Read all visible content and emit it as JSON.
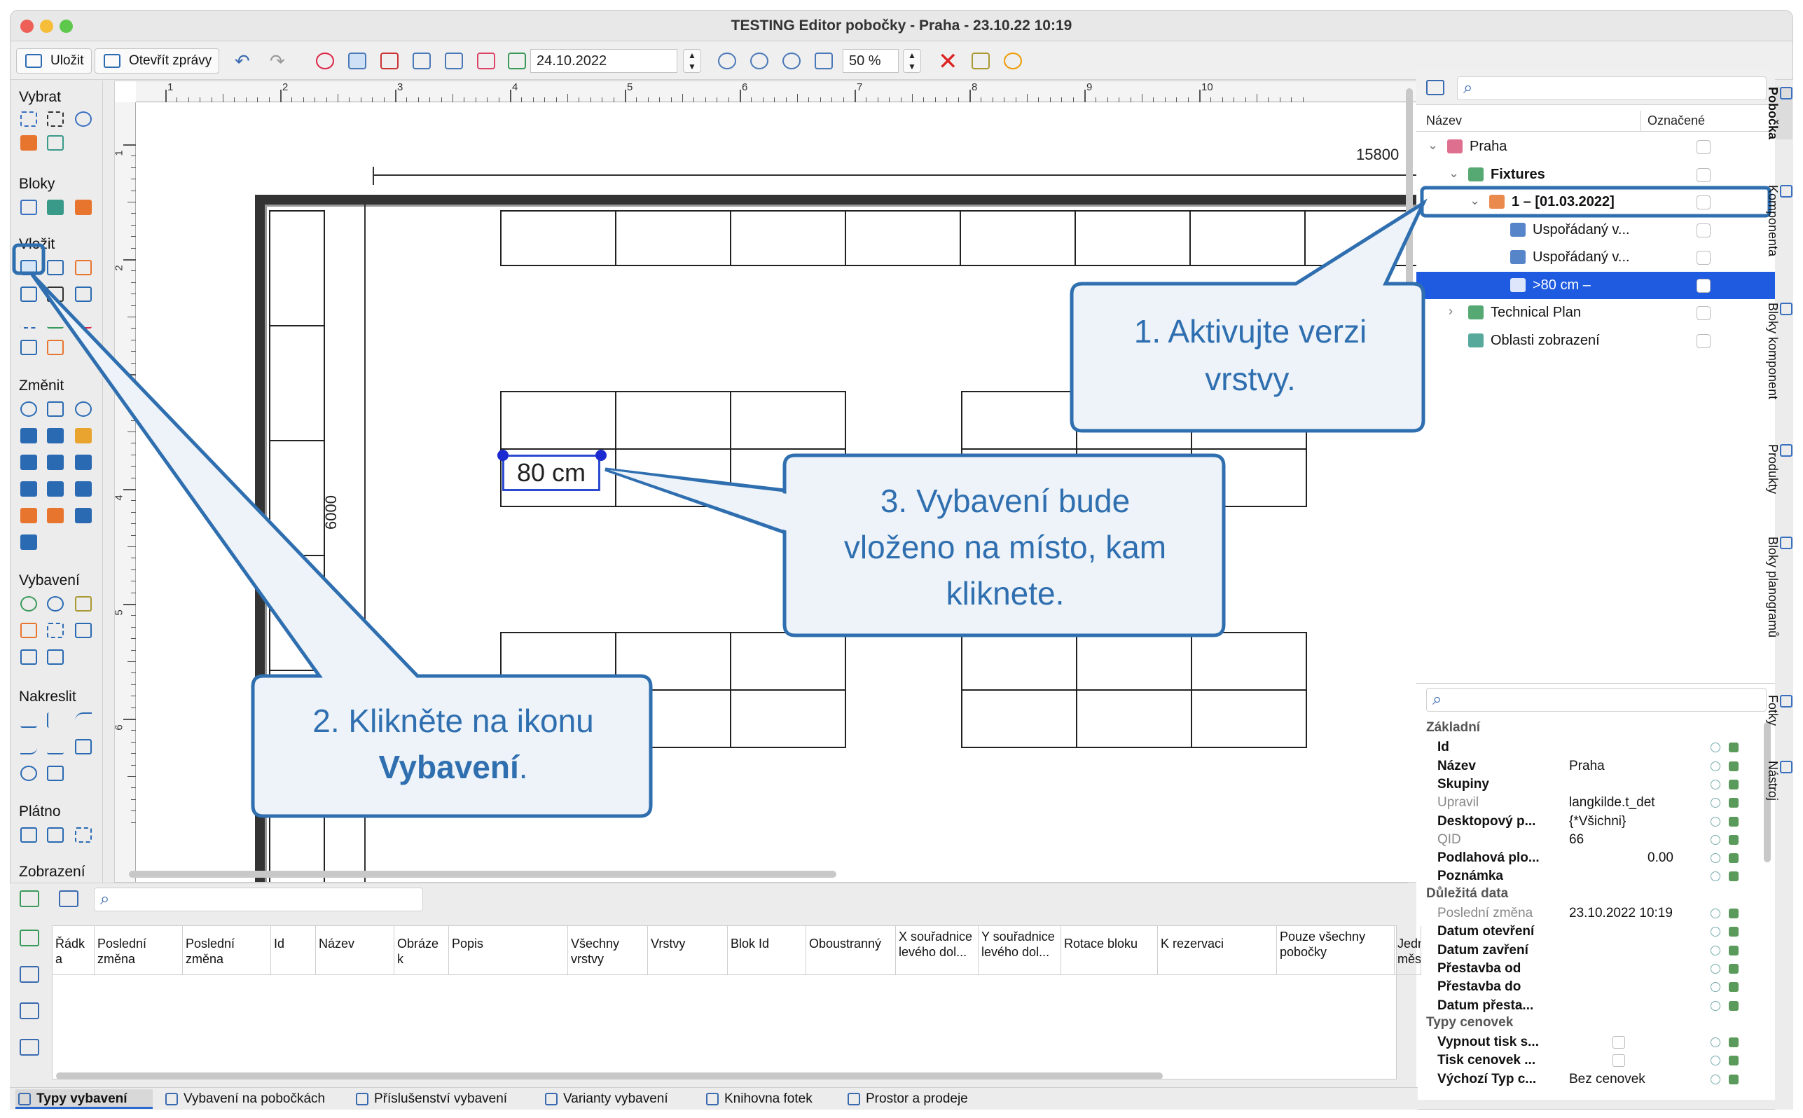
{
  "window": {
    "title": "TESTING Editor pobočky - Praha - 23.10.22 10:19"
  },
  "toolbar": {
    "save": "Uložit",
    "open_reports": "Otevřít zprávy",
    "date": "24.10.2022",
    "zoom": "50 %"
  },
  "left_groups": [
    "Vybrat",
    "Bloky",
    "Vložit",
    "Změnit",
    "Vybavení",
    "Nakreslit",
    "Plátno",
    "Zobrazení"
  ],
  "ruler": {
    "top": [
      "1",
      "2",
      "3",
      "4",
      "5",
      "6",
      "7",
      "8",
      "9",
      "10"
    ],
    "left": [
      "1",
      "2",
      "3",
      "4",
      "5",
      "6"
    ]
  },
  "canvas": {
    "dim_top": "15800",
    "dim_left": "6000",
    "fixture_label": "80 cm"
  },
  "tree": {
    "header_name": "Název",
    "header_marked": "Označené",
    "items": [
      "Praha",
      "Fixtures",
      "1 – [01.03.2022]",
      "Uspořádaný v...",
      "Uspořádaný v...",
      ">80 cm –",
      "Technical Plan",
      "Oblasti zobrazení"
    ]
  },
  "props": {
    "sec_basic": "Základní",
    "sec_important": "Důležitá data",
    "sec_price": "Typy cenovek",
    "rows": [
      {
        "k": "Id",
        "v": ""
      },
      {
        "k": "Název",
        "v": "Praha"
      },
      {
        "k": "Skupiny",
        "v": ""
      },
      {
        "k": "Upravil",
        "v": "langkilde.t_det"
      },
      {
        "k": "Desktopový p...",
        "v": "{*Všichni}"
      },
      {
        "k": "QID",
        "v": "66"
      },
      {
        "k": "Podlahová plo...",
        "v": "0.00"
      },
      {
        "k": "Poznámka",
        "v": ""
      },
      {
        "k": "Poslední změna",
        "v": "23.10.2022 10:19"
      },
      {
        "k": "Datum otevření",
        "v": ""
      },
      {
        "k": "Datum zavření",
        "v": ""
      },
      {
        "k": "Přestavba od",
        "v": ""
      },
      {
        "k": "Přestavba do",
        "v": ""
      },
      {
        "k": "Datum přesta...",
        "v": ""
      },
      {
        "k": "Vypnout tisk s...",
        "v": ""
      },
      {
        "k": "Tisk cenovek ...",
        "v": ""
      },
      {
        "k": "Výchozí Typ c...",
        "v": "Bez cenovek"
      }
    ]
  },
  "vtabs": [
    "Pobočka",
    "Komponenta",
    "Bloky komponent",
    "Produkty",
    "Bloky planogramů",
    "Fotky",
    "Nástroj"
  ],
  "grid_cols": [
    "Řádk a",
    "Poslední změna",
    "Poslední změna",
    "Id",
    "Název",
    "Obráze k",
    "Popis",
    "Všechny vrstvy",
    "Vrstvy",
    "Blok Id",
    "Oboustranný",
    "X souřadnice levého dol...",
    "Y souřadnice levého dol...",
    "Rotace bloku",
    "K rezervaci",
    "Pouze všechny pobočky",
    "Jedr měs"
  ],
  "bottom_tabs": [
    "Typy vybavení",
    "Vybavení na pobočkách",
    "Příslušenství vybavení",
    "Varianty vybavení",
    "Knihovna fotek",
    "Prostor a prodeje"
  ],
  "callouts": {
    "c1a": "1. Aktivujte verzi",
    "c1b": "vrstvy.",
    "c2a": "2. Klikněte na ikonu",
    "c2b": "Vybavení",
    "c2c": ".",
    "c3a": "3. Vybavení bude",
    "c3b": "vloženo na místo, kam",
    "c3c": "kliknete."
  }
}
